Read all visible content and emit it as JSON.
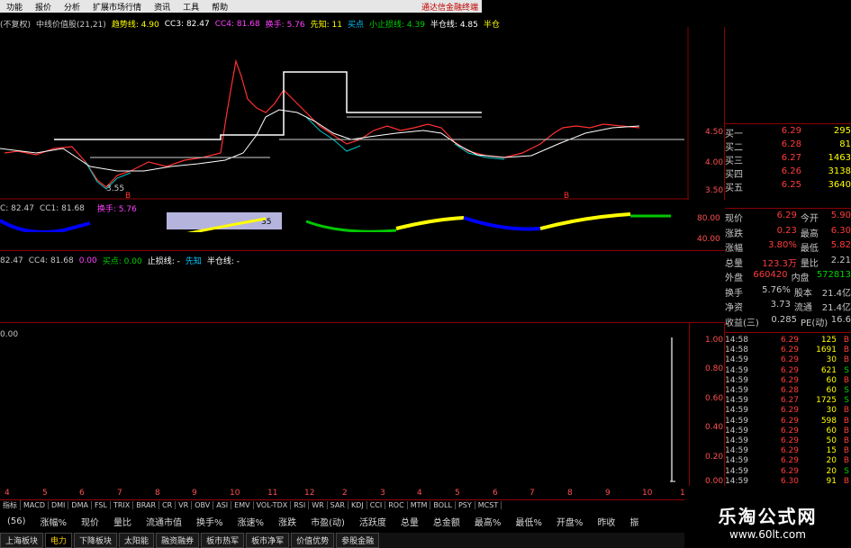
{
  "menu": {
    "items": [
      "功能",
      "报价",
      "分析",
      "扩展市场行情",
      "资讯",
      "工具",
      "帮助"
    ],
    "brand": "通达信金融终端"
  },
  "main_info": {
    "prefix": "(不复权)",
    "indicator": "中线价值股(21,21)",
    "trend_label": "趋势线: 4.90",
    "cc3": "CC3: 82.47",
    "cc4": "CC4: 81.68",
    "turnover": "换手: 5.76",
    "lead": "先知: 11",
    "buy": "买点",
    "stop": "小止损线: 4.39",
    "half": "半仓线: 4.85",
    "half2": "半仓"
  },
  "sub1_info": {
    "cc": "C: 82.47",
    "cc1": "CC1: 81.68",
    "turnover": "换手: 5.76"
  },
  "sub2_info": {
    "a": "82.47",
    "b": "CC4: 81.68",
    "c": "0.00",
    "d": "买点: 0.00",
    "e": "止损线: -",
    "f": "先知",
    "g": "半仓线: -"
  },
  "vol_info": {
    "val": "0.00"
  },
  "main_axis": [
    "4.50",
    "4.00",
    "3.50"
  ],
  "sub1_axis": [
    "80.00",
    "40.00"
  ],
  "vol_axis": [
    "1.00",
    "0.80",
    "0.60",
    "0.40",
    "0.20",
    "0.00"
  ],
  "low_label": "3.55",
  "label_box": "35",
  "indicator_tabs": [
    "指标",
    "MACD",
    "DMI",
    "DMA",
    "FSL",
    "TRIX",
    "BRAR",
    "CR",
    "VR",
    "OBV",
    "ASI",
    "EMV",
    "VOL-TDX",
    "RSI",
    "WR",
    "SAR",
    "KDJ",
    "CCI",
    "ROC",
    "MTM",
    "BOLL",
    "PSY",
    "MCST"
  ],
  "month_marks": [
    "4",
    "5",
    "6",
    "7",
    "8",
    "9",
    "10",
    "11",
    "12",
    "2",
    "3",
    "4",
    "5",
    "6",
    "7",
    "8",
    "9",
    "10",
    "1"
  ],
  "column_headers": [
    "(56)",
    "涨幅%",
    "现价",
    "量比",
    "流通市值",
    "换手%",
    "涨速%",
    "涨跌",
    "市盈(动)",
    "活跃度",
    "总量",
    "总金额",
    "最高%",
    "最低%",
    "开盘%",
    "昨收",
    "振"
  ],
  "bottom_tabs": [
    "上海板块",
    "电力",
    "下降板块",
    "太阳能",
    "融资融券",
    "板市热军",
    "板市净军",
    "价值优势",
    "参股金融"
  ],
  "bottom_tab_active": 1,
  "quote": {
    "bids": [
      {
        "k": "买一",
        "p": "6.29",
        "v": "295"
      },
      {
        "k": "买二",
        "p": "6.28",
        "v": "81"
      },
      {
        "k": "买三",
        "p": "6.27",
        "v": "1463"
      },
      {
        "k": "买四",
        "p": "6.26",
        "v": "3138"
      },
      {
        "k": "买五",
        "p": "6.25",
        "v": "3640"
      }
    ],
    "stats": [
      {
        "k": "现价",
        "v": "6.29",
        "k2": "今开",
        "v2": "5.90"
      },
      {
        "k": "涨跌",
        "v": "0.23",
        "k2": "最高",
        "v2": "6.30"
      },
      {
        "k": "涨幅",
        "v": "3.80%",
        "k2": "最低",
        "v2": "5.82"
      },
      {
        "k": "总量",
        "v": "123.3万",
        "k2": "量比",
        "v2": "2.21"
      },
      {
        "k": "外盘",
        "v": "660420",
        "k2": "内盘",
        "v2": "572813"
      },
      {
        "k": "换手",
        "v": "5.76%",
        "k2": "股本",
        "v2": "21.4亿"
      },
      {
        "k": "净资",
        "v": "3.73",
        "k2": "流通",
        "v2": "21.4亿"
      },
      {
        "k": "收益(三)",
        "v": "0.285",
        "k2": "PE(动)",
        "v2": "16.6"
      }
    ],
    "deals": [
      {
        "t": "14:58",
        "p": "6.29",
        "v": "125",
        "bs": "B",
        "c": "red"
      },
      {
        "t": "14:58",
        "p": "6.29",
        "v": "1691",
        "bs": "B",
        "c": "red"
      },
      {
        "t": "14:59",
        "p": "6.29",
        "v": "30",
        "bs": "B",
        "c": "red"
      },
      {
        "t": "14:59",
        "p": "6.29",
        "v": "621",
        "bs": "S",
        "c": "grn"
      },
      {
        "t": "14:59",
        "p": "6.29",
        "v": "60",
        "bs": "B",
        "c": "red"
      },
      {
        "t": "14:59",
        "p": "6.28",
        "v": "60",
        "bs": "S",
        "c": "grn"
      },
      {
        "t": "14:59",
        "p": "6.27",
        "v": "1725",
        "bs": "S",
        "c": "grn"
      },
      {
        "t": "14:59",
        "p": "6.29",
        "v": "30",
        "bs": "B",
        "c": "red"
      },
      {
        "t": "14:59",
        "p": "6.29",
        "v": "598",
        "bs": "B",
        "c": "red"
      },
      {
        "t": "14:59",
        "p": "6.29",
        "v": "60",
        "bs": "B",
        "c": "red"
      },
      {
        "t": "14:59",
        "p": "6.29",
        "v": "50",
        "bs": "B",
        "c": "red"
      },
      {
        "t": "14:59",
        "p": "6.29",
        "v": "15",
        "bs": "B",
        "c": "red"
      },
      {
        "t": "14:59",
        "p": "6.29",
        "v": "20",
        "bs": "B",
        "c": "red"
      },
      {
        "t": "14:59",
        "p": "6.29",
        "v": "20",
        "bs": "S",
        "c": "grn"
      },
      {
        "t": "14:59",
        "p": "6.30",
        "v": "91",
        "bs": "B",
        "c": "red"
      }
    ]
  },
  "watermark": {
    "line1": "乐淘公式网",
    "line2": "www.60lt.com"
  }
}
